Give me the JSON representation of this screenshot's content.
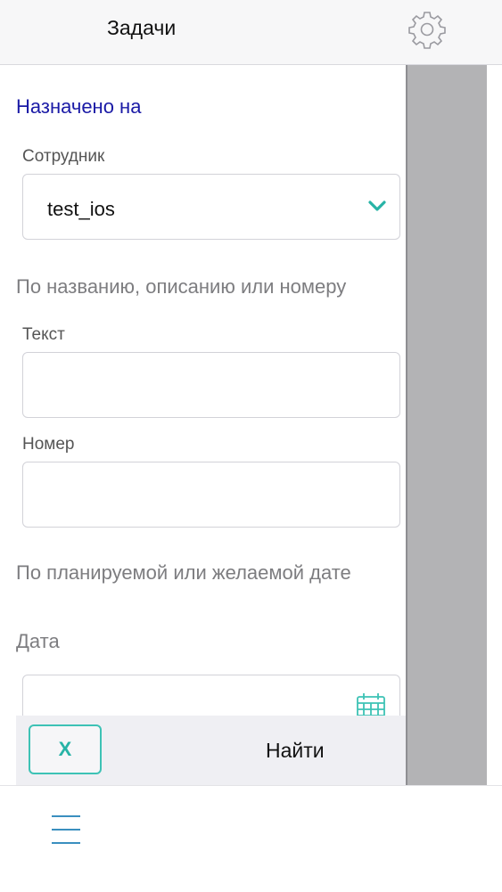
{
  "header": {
    "title": "Задачи",
    "settings_icon": "gear-icon"
  },
  "assigned": {
    "section_title": "Назначено на",
    "employee_label": "Сотрудник",
    "employee_value": "test_ios"
  },
  "text_search": {
    "section_title": "По названию, описанию или номеру",
    "text_label": "Текст",
    "text_value": "",
    "number_label": "Номер",
    "number_value": ""
  },
  "date_search": {
    "section_title": "По планируемой или желаемой дате",
    "date_label": "Дата",
    "date_value": ""
  },
  "actions": {
    "clear_label": "X",
    "find_label": "Найти"
  },
  "colors": {
    "accent": "#3dc2b5",
    "section_blue": "#1a1aa6",
    "menu": "#3a8fbf"
  }
}
